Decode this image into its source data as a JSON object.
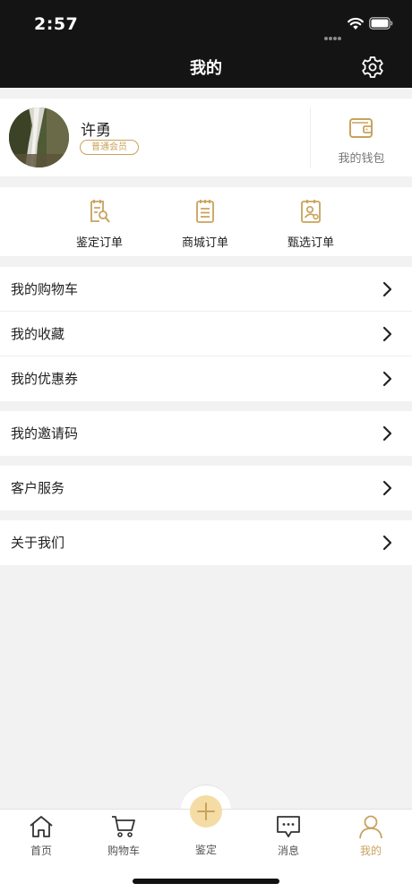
{
  "status_bar": {
    "time": "2:57"
  },
  "nav": {
    "title": "我的"
  },
  "profile": {
    "name": "许勇",
    "member_level": "普通会员",
    "wallet_label": "我的钱包"
  },
  "orders": [
    {
      "label": "鉴定订单",
      "icon": "appraisal-order-icon"
    },
    {
      "label": "商城订单",
      "icon": "mall-order-icon"
    },
    {
      "label": "甄选订单",
      "icon": "curated-order-icon"
    }
  ],
  "menu_groups": [
    {
      "items": [
        {
          "label": "我的购物车"
        },
        {
          "label": "我的收藏"
        },
        {
          "label": "我的优惠券"
        }
      ]
    },
    {
      "items": [
        {
          "label": "我的邀请码"
        }
      ]
    },
    {
      "items": [
        {
          "label": "客户服务"
        }
      ]
    },
    {
      "items": [
        {
          "label": "关于我们"
        }
      ]
    }
  ],
  "tab_bar": {
    "tabs": [
      {
        "label": "首页",
        "icon": "home-icon"
      },
      {
        "label": "购物车",
        "icon": "cart-icon"
      },
      {
        "label": "鉴定",
        "icon": "plus-icon"
      },
      {
        "label": "消息",
        "icon": "message-icon"
      },
      {
        "label": "我的",
        "icon": "profile-icon",
        "active": true
      }
    ]
  },
  "colors": {
    "accent_gold": "#c9a25d",
    "header_black": "#141414",
    "center_button": "#f4dca4",
    "background": "#f2f2f2"
  }
}
